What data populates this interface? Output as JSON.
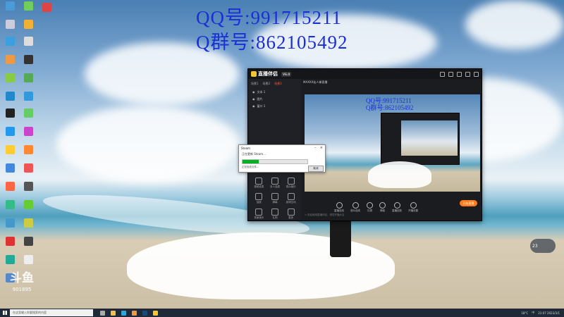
{
  "overlay": {
    "qq": "QQ号:991715211",
    "group": "Q群号:862105492"
  },
  "app": {
    "name": "直播伴侣",
    "version": "V6.0",
    "sidebar_tabs": [
      "场景1",
      "场景2",
      "场景3"
    ],
    "scenes": [
      "文本 1",
      "图片",
      "窗口 1"
    ],
    "tools": [
      "视频连麦",
      "多人连麦",
      "观众娱乐",
      "抽奖",
      "弹幕",
      "游戏互动",
      "背景音乐",
      "礼物",
      "更多"
    ],
    "preview_title": "MAXXX仙人掌直播",
    "bottom_tools": [
      "直播连线",
      "观众连线",
      "礼物",
      "弹幕",
      "直播回放",
      "开播设置"
    ],
    "start_button": "开始直播",
    "status": "< 欢迎使用直播伴侣，祝您开播大吉"
  },
  "dialog": {
    "title": "Steam",
    "message": "正在更新 Steam...",
    "progress_percent": 25,
    "sub": "正在检查文件...",
    "cancel": "取消"
  },
  "watermark": {
    "logo": "斗鱼",
    "id": "901895"
  },
  "weather": {
    "temp": "23"
  },
  "taskbar": {
    "search_placeholder": "在这里输入你要搜索的内容",
    "tray_temp": "18°C",
    "tray_lang": "中",
    "tray_time": "21:07",
    "tray_date": "2023/3/1"
  },
  "colors": {
    "overlay_text": "#1a2fd6",
    "accent": "#ff7a1a",
    "progress": "#06b025"
  }
}
